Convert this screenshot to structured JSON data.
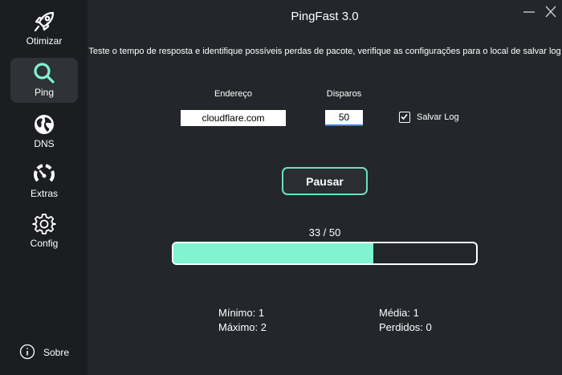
{
  "window": {
    "title": "PingFast 3.0"
  },
  "sidebar": {
    "items": [
      {
        "label": "Otimizar",
        "icon": "rocket-icon",
        "active": false
      },
      {
        "label": "Ping",
        "icon": "magnifier-icon",
        "active": true
      },
      {
        "label": "DNS",
        "icon": "globe-icon",
        "active": false
      },
      {
        "label": "Extras",
        "icon": "gauge-icon",
        "active": false
      },
      {
        "label": "Config",
        "icon": "gear-icon",
        "active": false
      }
    ],
    "about": {
      "label": "Sobre",
      "icon": "info-icon"
    }
  },
  "main": {
    "description": "Teste o tempo de resposta e identifique possíveis perdas de pacote, verifique as configurações para o local de salvar log",
    "address": {
      "label": "Endereço",
      "value": "cloudflare.com"
    },
    "shots": {
      "label": "Disparos",
      "value": "50"
    },
    "save_log": {
      "label": "Salvar Log",
      "checked": true
    },
    "pause_button": "Pausar",
    "progress": {
      "text": "33 / 50",
      "current": 33,
      "total": 50
    },
    "stats": {
      "min": "Mínimo: 1",
      "max": "Máximo: 2",
      "avg": "Média: 1",
      "lost": "Perdidos: 0"
    }
  },
  "colors": {
    "accent": "#7ef5d0",
    "button_border": "#6ddfc0",
    "background": "#23262b",
    "sidebar": "#1b1d21"
  }
}
